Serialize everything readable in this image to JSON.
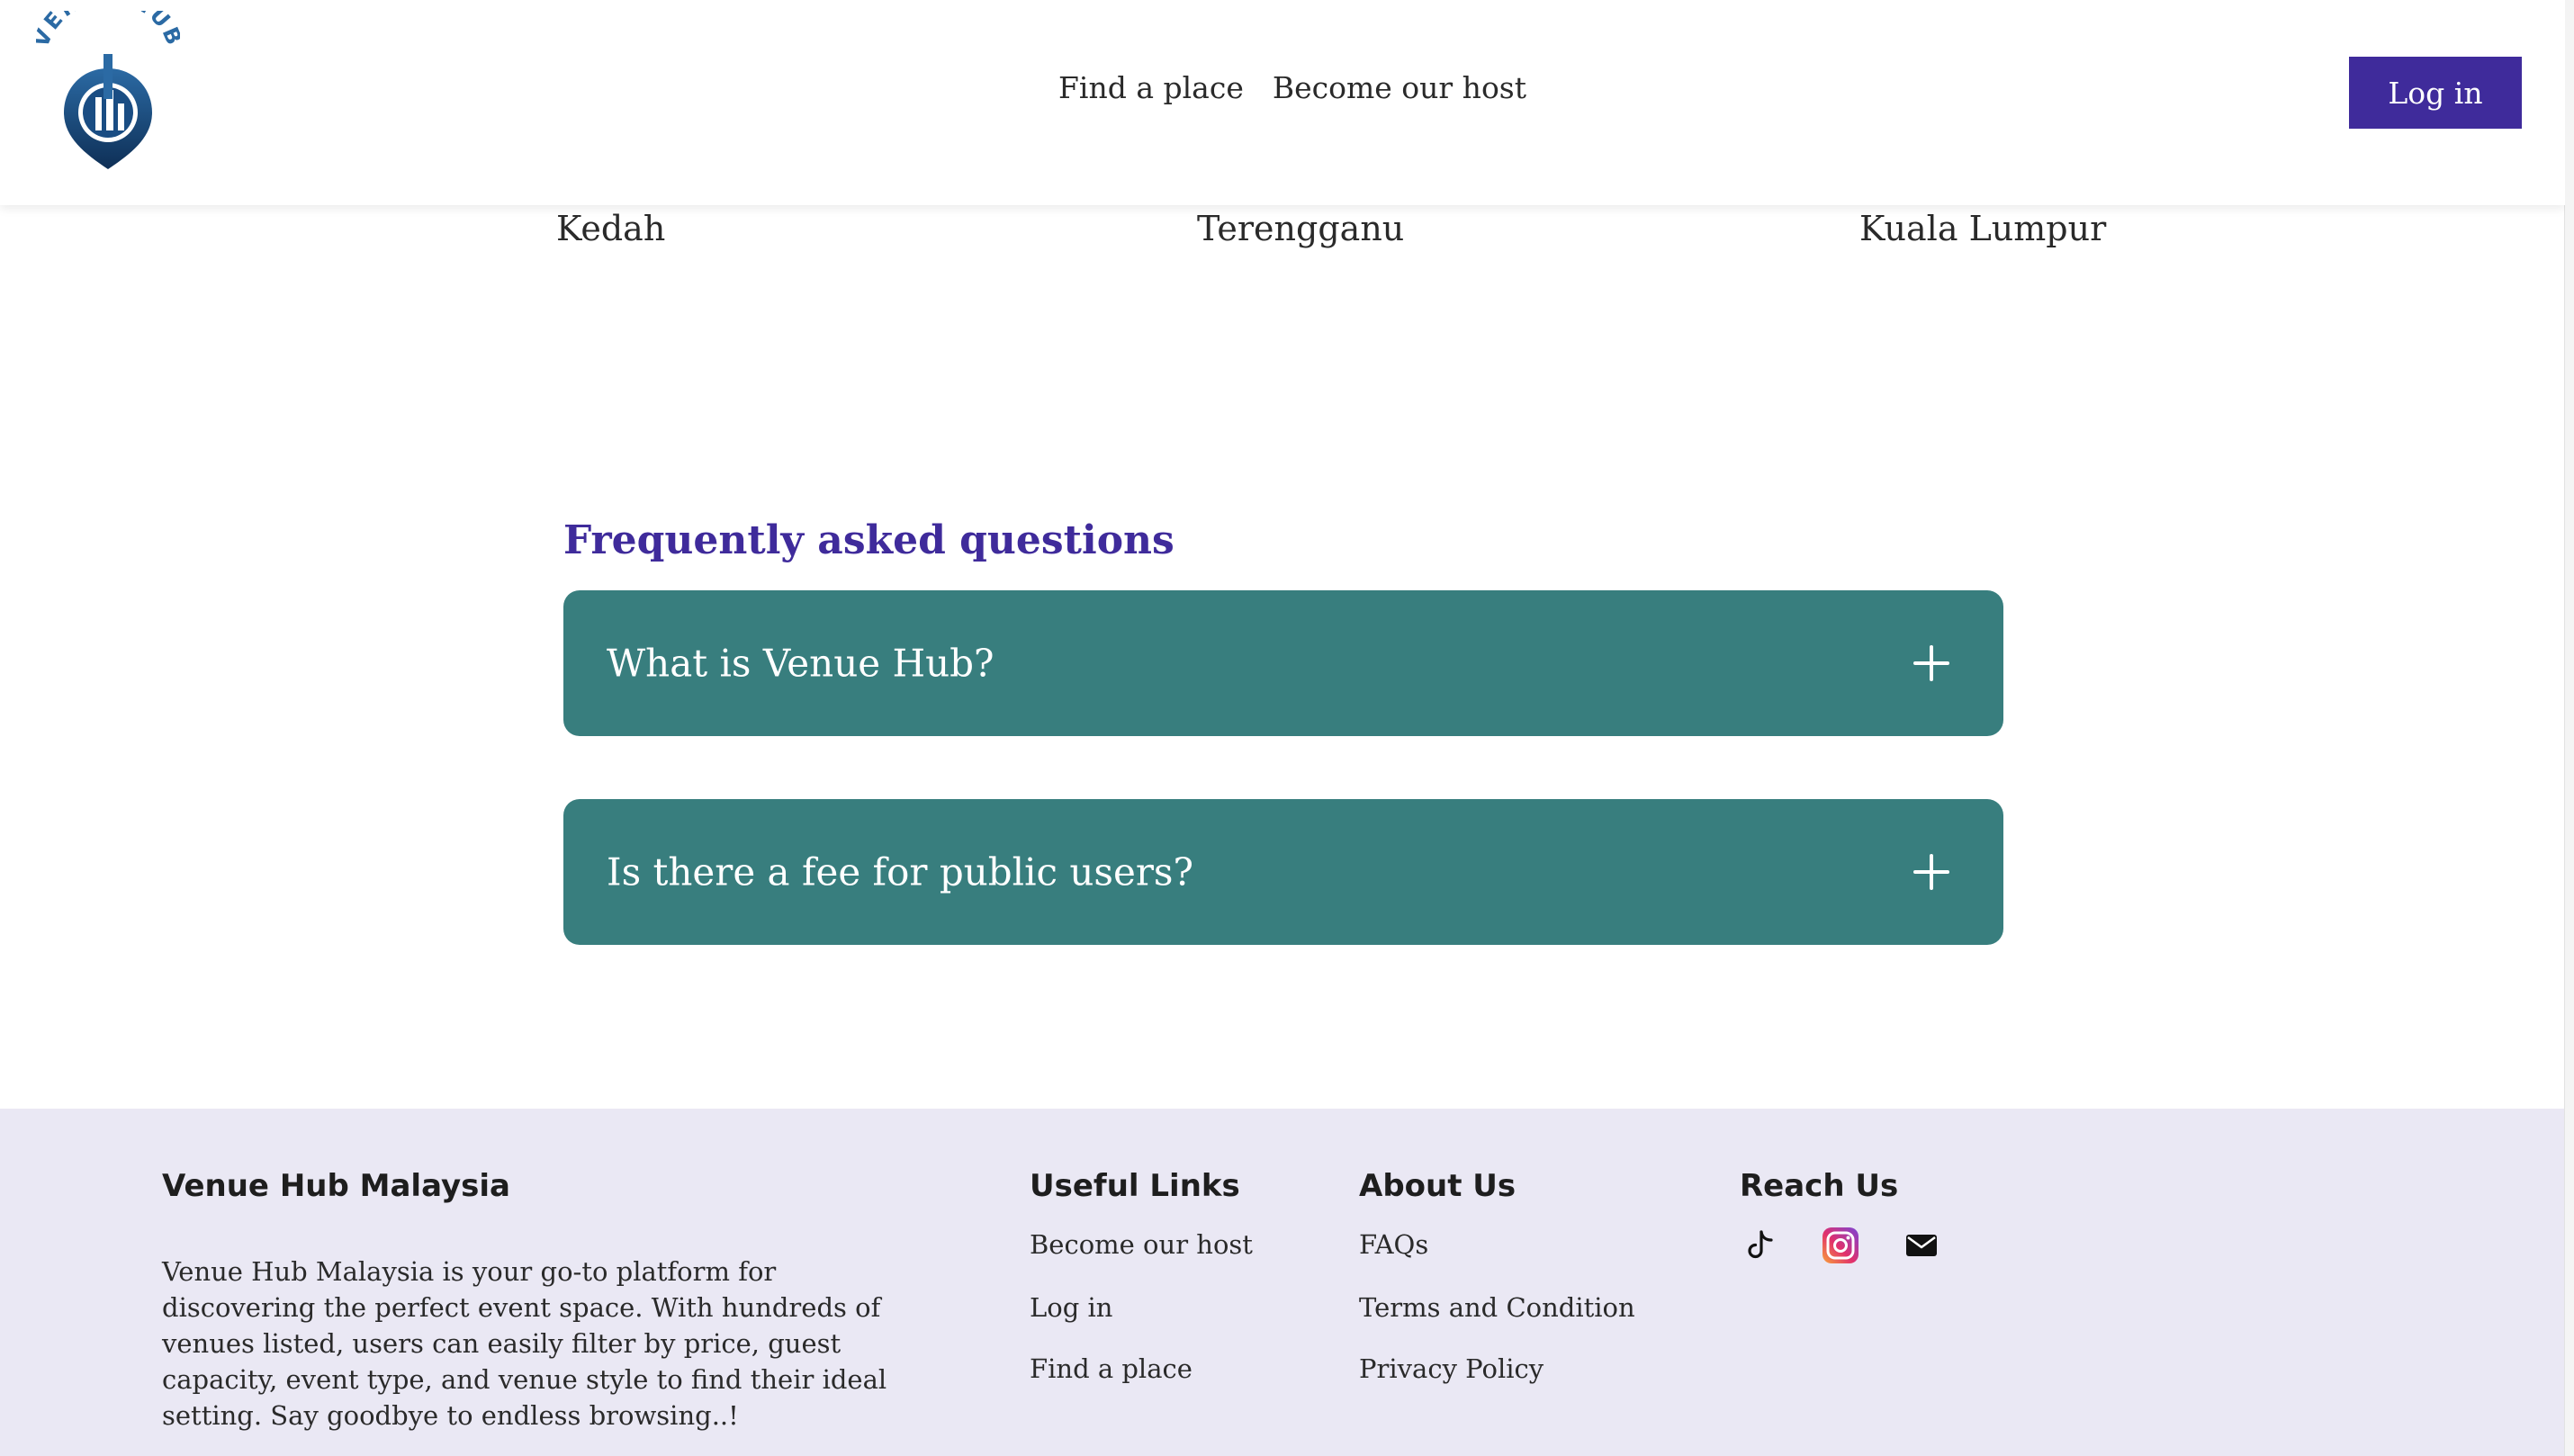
{
  "header": {
    "logo_text": "VENUE HUB",
    "nav": [
      {
        "label": "Find a place"
      },
      {
        "label": "Become our host"
      }
    ],
    "login_label": "Log in"
  },
  "states": [
    "Kedah",
    "Terengganu",
    "Kuala Lumpur"
  ],
  "faq": {
    "title": "Frequently asked questions",
    "items": [
      {
        "question": "What is Venue Hub?"
      },
      {
        "question": "Is there a fee for public users?"
      }
    ]
  },
  "footer": {
    "about_title": "Venue Hub Malaysia",
    "about_text": "Venue Hub Malaysia is your go-to platform for discovering the perfect event space. With hundreds of venues listed, users can easily filter by price, guest capacity, event type, and venue style to find their ideal setting. Say goodbye to endless browsing..!",
    "useful_links_title": "Useful Links",
    "useful_links": [
      {
        "label": "Become our host"
      },
      {
        "label": "Log in"
      },
      {
        "label": "Find a place"
      }
    ],
    "about_us_title": "About  Us",
    "about_us_links": [
      {
        "label": " FAQs"
      },
      {
        "label": "Terms and Condition"
      },
      {
        "label": "Privacy Policy"
      }
    ],
    "reach_us_title": "Reach Us",
    "social_icons": [
      "tiktok-icon",
      "instagram-icon",
      "mail-icon"
    ]
  },
  "colors": {
    "brand_primary": "#3f2b9b",
    "faq_bg": "#387e7e",
    "footer_bg": "#eae8f4",
    "logo_blue": "#2b6aa4"
  }
}
